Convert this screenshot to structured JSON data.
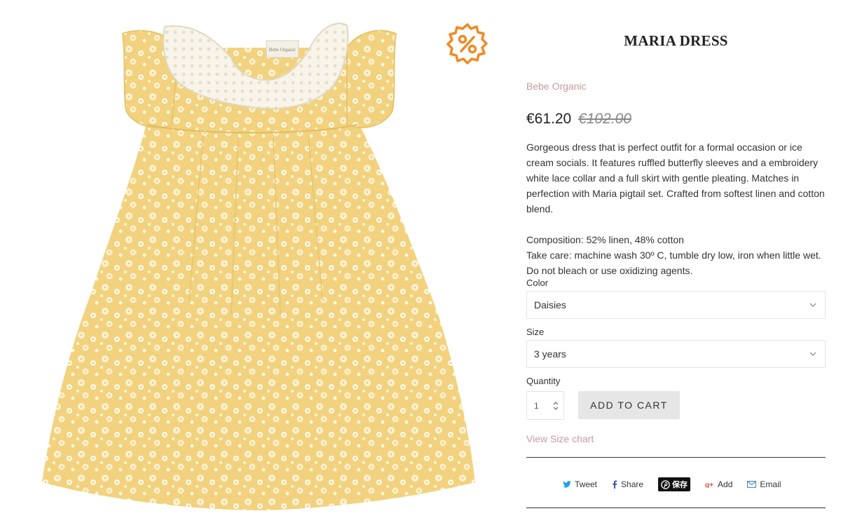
{
  "product": {
    "title": "MARIA DRESS",
    "vendor": "Bebe Organic",
    "price": "€61.20",
    "compare_price": "€102.00",
    "image_label": "Bebe Organic",
    "description": [
      "Gorgeous dress that is perfect outfit for a formal occasion or ice cream socials. It features ruffled butterfly sleeves and a embroidery white lace collar and a full skirt with gentle pleating. Matches in perfection with Maria pigtail set. Crafted from softest linen and cotton blend.",
      "Composition: 52% linen, 48% cotton",
      "Take care: machine wash 30º C, tumble dry low, iron when little wet.",
      "Do not bleach or use oxidizing agents."
    ]
  },
  "badge": {
    "icon": "percent-icon",
    "color": "#f08a24"
  },
  "options": {
    "color_label": "Color",
    "color_value": "Daisies",
    "size_label": "Size",
    "size_value": "3 years",
    "quantity_label": "Quantity",
    "quantity_value": "1"
  },
  "actions": {
    "add_to_cart": "ADD TO CART",
    "size_chart": "View Size chart"
  },
  "share": {
    "tweet": "Tweet",
    "share": "Share",
    "pin": "保存",
    "add": "Add",
    "email": "Email"
  },
  "colors": {
    "accent_pink": "#c79a9f",
    "twitter": "#1da1f2",
    "google_plus": "#dc4e41",
    "dress_yellow": "#f3d98a"
  }
}
